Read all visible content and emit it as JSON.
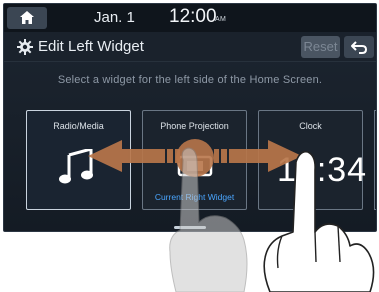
{
  "status": {
    "date": "Jan. 1",
    "time": "12:00",
    "ampm": "AM"
  },
  "header": {
    "title": "Edit Left Widget",
    "reset_label": "Reset"
  },
  "instruction": "Select a widget for the left side of the Home Screen.",
  "widgets": [
    {
      "label": "Radio/Media",
      "icon": "music-note-icon",
      "selected": true
    },
    {
      "label": "Phone Projection",
      "icon": "phone-projection-icon",
      "sub": "Current Right Widget"
    },
    {
      "label": "Clock",
      "display": "12:34",
      "icon": "clock"
    }
  ],
  "gesture": {
    "type": "drag",
    "direction": "left-right",
    "arrow_color": "#b8764a"
  }
}
